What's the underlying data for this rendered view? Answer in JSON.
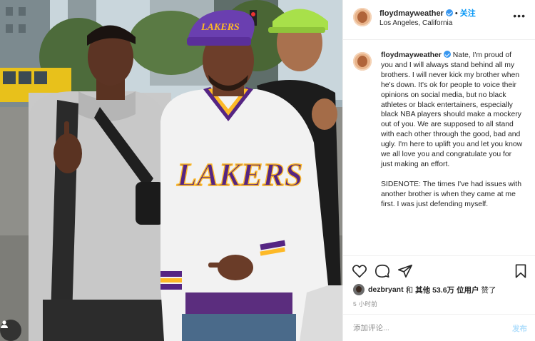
{
  "header": {
    "username": "floydmayweather",
    "dot": "•",
    "follow_label": "关注",
    "location": "Los Angeles, California"
  },
  "caption": {
    "username": "floydmayweather",
    "text": "Nate, I'm proud of you and I will always stand behind all my brothers. I will never kick my brother when he's down. It's ok for people to voice their opinions on social media, but no black athletes or black entertainers, especially black NBA players should make a mockery out of you. We are supposed to all stand with each other through the good, bad and ugly. I'm here to uplift you and let you know we all love you and congratulate you for just making an effort.\n\nSIDENOTE: The times I've had issues with another brother is when they came at me first. I was just defending myself."
  },
  "photo": {
    "jacket_text": "LAKERS",
    "cap_text": "LAKERS"
  },
  "likes": {
    "user": "dezbryant",
    "and": "和",
    "others": "其他",
    "count": "53.6万",
    "suffix": "位用户",
    "liked": "赞了"
  },
  "timestamp": "5 小时前",
  "comment": {
    "placeholder": "添加评论...",
    "post_label": "发布"
  },
  "colors": {
    "accent": "#0095f6",
    "verified": "#3897f0",
    "post_disabled": "#b2dffc",
    "lakers_purple": "#552583",
    "lakers_gold": "#FDB927"
  },
  "icons": [
    "heart-icon",
    "comment-icon",
    "share-icon",
    "bookmark-icon",
    "verified-icon",
    "more-icon",
    "person-tag-icon"
  ]
}
